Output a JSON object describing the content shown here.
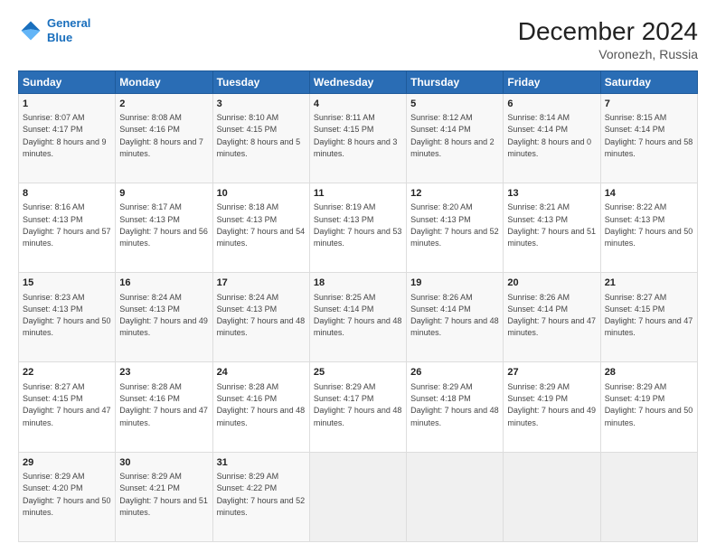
{
  "header": {
    "logo_line1": "General",
    "logo_line2": "Blue",
    "title": "December 2024",
    "subtitle": "Voronezh, Russia"
  },
  "days_of_week": [
    "Sunday",
    "Monday",
    "Tuesday",
    "Wednesday",
    "Thursday",
    "Friday",
    "Saturday"
  ],
  "weeks": [
    [
      {
        "day": "1",
        "sunrise": "8:07 AM",
        "sunset": "4:17 PM",
        "daylight": "8 hours and 9 minutes."
      },
      {
        "day": "2",
        "sunrise": "8:08 AM",
        "sunset": "4:16 PM",
        "daylight": "8 hours and 7 minutes."
      },
      {
        "day": "3",
        "sunrise": "8:10 AM",
        "sunset": "4:15 PM",
        "daylight": "8 hours and 5 minutes."
      },
      {
        "day": "4",
        "sunrise": "8:11 AM",
        "sunset": "4:15 PM",
        "daylight": "8 hours and 3 minutes."
      },
      {
        "day": "5",
        "sunrise": "8:12 AM",
        "sunset": "4:14 PM",
        "daylight": "8 hours and 2 minutes."
      },
      {
        "day": "6",
        "sunrise": "8:14 AM",
        "sunset": "4:14 PM",
        "daylight": "8 hours and 0 minutes."
      },
      {
        "day": "7",
        "sunrise": "8:15 AM",
        "sunset": "4:14 PM",
        "daylight": "7 hours and 58 minutes."
      }
    ],
    [
      {
        "day": "8",
        "sunrise": "8:16 AM",
        "sunset": "4:13 PM",
        "daylight": "7 hours and 57 minutes."
      },
      {
        "day": "9",
        "sunrise": "8:17 AM",
        "sunset": "4:13 PM",
        "daylight": "7 hours and 56 minutes."
      },
      {
        "day": "10",
        "sunrise": "8:18 AM",
        "sunset": "4:13 PM",
        "daylight": "7 hours and 54 minutes."
      },
      {
        "day": "11",
        "sunrise": "8:19 AM",
        "sunset": "4:13 PM",
        "daylight": "7 hours and 53 minutes."
      },
      {
        "day": "12",
        "sunrise": "8:20 AM",
        "sunset": "4:13 PM",
        "daylight": "7 hours and 52 minutes."
      },
      {
        "day": "13",
        "sunrise": "8:21 AM",
        "sunset": "4:13 PM",
        "daylight": "7 hours and 51 minutes."
      },
      {
        "day": "14",
        "sunrise": "8:22 AM",
        "sunset": "4:13 PM",
        "daylight": "7 hours and 50 minutes."
      }
    ],
    [
      {
        "day": "15",
        "sunrise": "8:23 AM",
        "sunset": "4:13 PM",
        "daylight": "7 hours and 50 minutes."
      },
      {
        "day": "16",
        "sunrise": "8:24 AM",
        "sunset": "4:13 PM",
        "daylight": "7 hours and 49 minutes."
      },
      {
        "day": "17",
        "sunrise": "8:24 AM",
        "sunset": "4:13 PM",
        "daylight": "7 hours and 48 minutes."
      },
      {
        "day": "18",
        "sunrise": "8:25 AM",
        "sunset": "4:14 PM",
        "daylight": "7 hours and 48 minutes."
      },
      {
        "day": "19",
        "sunrise": "8:26 AM",
        "sunset": "4:14 PM",
        "daylight": "7 hours and 48 minutes."
      },
      {
        "day": "20",
        "sunrise": "8:26 AM",
        "sunset": "4:14 PM",
        "daylight": "7 hours and 47 minutes."
      },
      {
        "day": "21",
        "sunrise": "8:27 AM",
        "sunset": "4:15 PM",
        "daylight": "7 hours and 47 minutes."
      }
    ],
    [
      {
        "day": "22",
        "sunrise": "8:27 AM",
        "sunset": "4:15 PM",
        "daylight": "7 hours and 47 minutes."
      },
      {
        "day": "23",
        "sunrise": "8:28 AM",
        "sunset": "4:16 PM",
        "daylight": "7 hours and 47 minutes."
      },
      {
        "day": "24",
        "sunrise": "8:28 AM",
        "sunset": "4:16 PM",
        "daylight": "7 hours and 48 minutes."
      },
      {
        "day": "25",
        "sunrise": "8:29 AM",
        "sunset": "4:17 PM",
        "daylight": "7 hours and 48 minutes."
      },
      {
        "day": "26",
        "sunrise": "8:29 AM",
        "sunset": "4:18 PM",
        "daylight": "7 hours and 48 minutes."
      },
      {
        "day": "27",
        "sunrise": "8:29 AM",
        "sunset": "4:19 PM",
        "daylight": "7 hours and 49 minutes."
      },
      {
        "day": "28",
        "sunrise": "8:29 AM",
        "sunset": "4:19 PM",
        "daylight": "7 hours and 50 minutes."
      }
    ],
    [
      {
        "day": "29",
        "sunrise": "8:29 AM",
        "sunset": "4:20 PM",
        "daylight": "7 hours and 50 minutes."
      },
      {
        "day": "30",
        "sunrise": "8:29 AM",
        "sunset": "4:21 PM",
        "daylight": "7 hours and 51 minutes."
      },
      {
        "day": "31",
        "sunrise": "8:29 AM",
        "sunset": "4:22 PM",
        "daylight": "7 hours and 52 minutes."
      },
      null,
      null,
      null,
      null
    ]
  ]
}
